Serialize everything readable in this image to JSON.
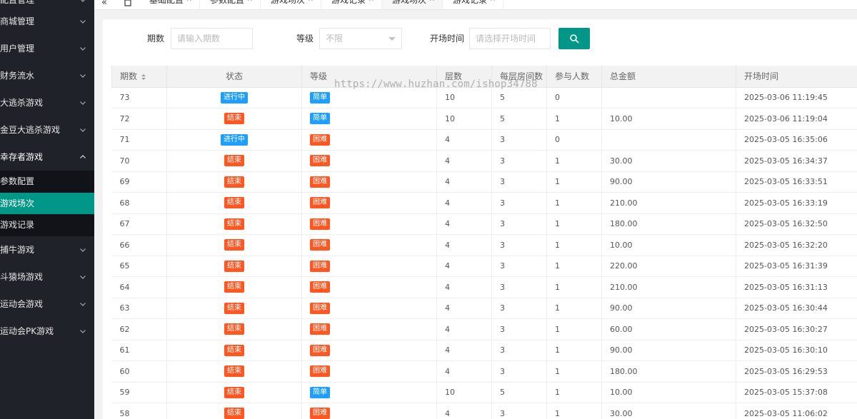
{
  "sidebar": {
    "items": [
      {
        "label": "配置管理"
      },
      {
        "label": "商城管理"
      },
      {
        "label": "用户管理"
      },
      {
        "label": "财务流水"
      },
      {
        "label": "大逃杀游戏"
      },
      {
        "label": "金豆大逃杀游戏"
      },
      {
        "label": "幸存者游戏"
      }
    ],
    "sub_items": [
      {
        "label": "参数配置"
      },
      {
        "label": "游戏场次"
      },
      {
        "label": "游戏记录"
      }
    ],
    "items_after": [
      {
        "label": "捕牛游戏"
      },
      {
        "label": "斗猿场游戏"
      },
      {
        "label": "运动会游戏"
      },
      {
        "label": "运动会PK游戏"
      }
    ]
  },
  "topbar": {
    "collapse_icon": "«",
    "tabs": [
      {
        "label": "基础配置"
      },
      {
        "label": "参数配置"
      },
      {
        "label": "游戏场次"
      },
      {
        "label": "游戏记录"
      },
      {
        "label": "游戏场次"
      },
      {
        "label": "游戏记录"
      }
    ],
    "active_tab": 4
  },
  "filters": {
    "period_label": "期数",
    "period_placeholder": "请输入期数",
    "level_label": "等级",
    "level_value": "不限",
    "time_label": "开场时间",
    "time_placeholder": "请选择开场时间"
  },
  "table": {
    "headers": [
      "期数",
      "状态",
      "等级",
      "层数",
      "每层房间数",
      "参与人数",
      "总金额",
      "开场时间"
    ],
    "rows": [
      {
        "id": "73",
        "status": "进行中",
        "level": "简单",
        "floors": "10",
        "rooms": "5",
        "players": "0",
        "amount": "",
        "time": "2025-03-06 11:19:45"
      },
      {
        "id": "72",
        "status": "结束",
        "level": "简单",
        "floors": "10",
        "rooms": "5",
        "players": "1",
        "amount": "10.00",
        "time": "2025-03-06 11:19:04"
      },
      {
        "id": "71",
        "status": "进行中",
        "level": "困难",
        "floors": "4",
        "rooms": "3",
        "players": "0",
        "amount": "",
        "time": "2025-03-05 16:35:06"
      },
      {
        "id": "70",
        "status": "结束",
        "level": "困难",
        "floors": "4",
        "rooms": "3",
        "players": "1",
        "amount": "30.00",
        "time": "2025-03-05 16:34:37"
      },
      {
        "id": "69",
        "status": "结束",
        "level": "困难",
        "floors": "4",
        "rooms": "3",
        "players": "1",
        "amount": "90.00",
        "time": "2025-03-05 16:33:51"
      },
      {
        "id": "68",
        "status": "结束",
        "level": "困难",
        "floors": "4",
        "rooms": "3",
        "players": "1",
        "amount": "210.00",
        "time": "2025-03-05 16:33:19"
      },
      {
        "id": "67",
        "status": "结束",
        "level": "困难",
        "floors": "4",
        "rooms": "3",
        "players": "1",
        "amount": "180.00",
        "time": "2025-03-05 16:32:50"
      },
      {
        "id": "66",
        "status": "结束",
        "level": "困难",
        "floors": "4",
        "rooms": "3",
        "players": "1",
        "amount": "10.00",
        "time": "2025-03-05 16:32:20"
      },
      {
        "id": "65",
        "status": "结束",
        "level": "困难",
        "floors": "4",
        "rooms": "3",
        "players": "1",
        "amount": "220.00",
        "time": "2025-03-05 16:31:39"
      },
      {
        "id": "64",
        "status": "结束",
        "level": "困难",
        "floors": "4",
        "rooms": "3",
        "players": "1",
        "amount": "210.00",
        "time": "2025-03-05 16:31:13"
      },
      {
        "id": "63",
        "status": "结束",
        "level": "困难",
        "floors": "4",
        "rooms": "3",
        "players": "1",
        "amount": "90.00",
        "time": "2025-03-05 16:30:44"
      },
      {
        "id": "62",
        "status": "结束",
        "level": "困难",
        "floors": "4",
        "rooms": "3",
        "players": "1",
        "amount": "60.00",
        "time": "2025-03-05 16:30:27"
      },
      {
        "id": "61",
        "status": "结束",
        "level": "困难",
        "floors": "4",
        "rooms": "3",
        "players": "1",
        "amount": "90.00",
        "time": "2025-03-05 16:30:10"
      },
      {
        "id": "60",
        "status": "结束",
        "level": "困难",
        "floors": "4",
        "rooms": "3",
        "players": "1",
        "amount": "180.00",
        "time": "2025-03-05 16:29:53"
      },
      {
        "id": "59",
        "status": "结束",
        "level": "简单",
        "floors": "10",
        "rooms": "5",
        "players": "1",
        "amount": "10.00",
        "time": "2025-03-05 15:37:08"
      },
      {
        "id": "58",
        "status": "结束",
        "level": "困难",
        "floors": "4",
        "rooms": "3",
        "players": "1",
        "amount": "30.00",
        "time": "2025-03-05 11:06:02"
      }
    ]
  },
  "badge_colors": {
    "进行中": "#1e9fff",
    "结束": "#ff5722",
    "简单": "#1e9fff",
    "困难": "#ff5722"
  },
  "watermark": "https://www.huzhan.com/ishop34788"
}
